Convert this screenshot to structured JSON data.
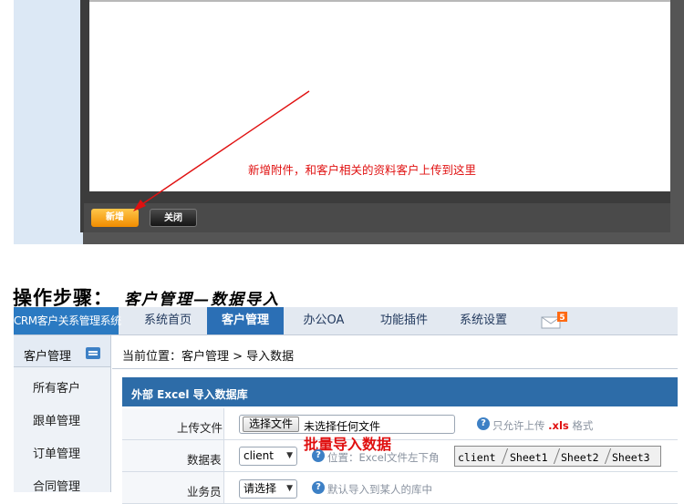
{
  "top_screenshot": {
    "buttons": {
      "new": "新增",
      "close": "关闭"
    },
    "annotation": "新增附件，和客户相关的资料客户上传到这里"
  },
  "heading": {
    "main": "操作步骤：",
    "sub": "客户管理—数据导入"
  },
  "app": {
    "brand": "CRM客户关系管理系统",
    "nav_tabs": [
      {
        "label": "系统首页",
        "active": false
      },
      {
        "label": "客户管理",
        "active": true
      },
      {
        "label": "办公OA",
        "active": false
      },
      {
        "label": "功能插件",
        "active": false
      },
      {
        "label": "系统设置",
        "active": false
      }
    ],
    "mail_badge": "5",
    "sidebar": {
      "title": "客户管理",
      "items": [
        "所有客户",
        "跟单管理",
        "订单管理",
        "合同管理"
      ]
    },
    "breadcrumb": "当前位置：客户管理 > 导入数据",
    "panel_title": "外部 Excel 导入数据库",
    "form": {
      "upload_label": "上传文件",
      "choose_file_button": "选择文件",
      "no_file_text": "未选择任何文件",
      "upload_hint_prefix": "只允许上传",
      "upload_hint_ext": ".xls",
      "upload_hint_suffix": "格式",
      "sheet_label": "数据表",
      "sheet_value": "client",
      "sheet_hint": "位置：Excel文件左下角",
      "owner_label": "业务员",
      "owner_value": "请选择",
      "owner_hint": "默认导入到某人的库中"
    },
    "annotation": "批量导入数据",
    "excel_sheets": [
      "client",
      "Sheet1",
      "Sheet2",
      "Sheet3"
    ]
  },
  "colors": {
    "accent_red": "#e01010",
    "nav_active": "#2b6fb5",
    "panel_header": "#2d6ca8",
    "button_orange": "#f08c00"
  }
}
